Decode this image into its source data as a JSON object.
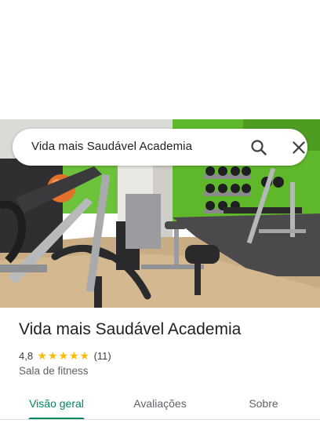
{
  "search": {
    "query": "Vida mais Saudável Academia",
    "search_icon": "search-icon",
    "close_icon": "close-icon"
  },
  "hero": {
    "image": "gym-interior-photo"
  },
  "place": {
    "title": "Vida mais Saudável Academia",
    "rating": "4,8",
    "stars": 5,
    "review_count": "(11)",
    "category": "Sala de fitness"
  },
  "tabs": [
    {
      "label": "Visão geral",
      "active": true
    },
    {
      "label": "Avaliações",
      "active": false
    },
    {
      "label": "Sobre",
      "active": false
    }
  ],
  "colors": {
    "accent": "#01875f",
    "star": "#fbbc04",
    "wall_green": "#5fb82a"
  }
}
